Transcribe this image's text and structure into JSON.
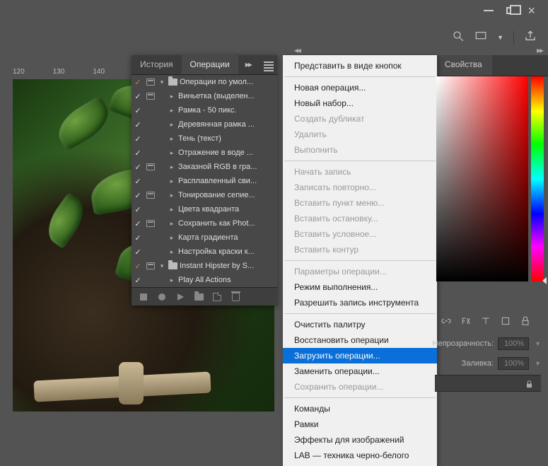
{
  "window": {
    "minimize": "minimize",
    "maximize": "maximize",
    "close": "×"
  },
  "ruler": [
    "120",
    "130",
    "140"
  ],
  "panel": {
    "tab_history": "История",
    "tab_actions": "Операции",
    "items": [
      {
        "check": "✓",
        "dialog": true,
        "expand": "▾",
        "folder": true,
        "label": "Операции по умол...",
        "group": true,
        "indent": 0
      },
      {
        "check": "✓",
        "dialog": true,
        "expand": "▸",
        "label": "Виньетка (выделен...",
        "indent": 1
      },
      {
        "check": "✓",
        "dialog": false,
        "expand": "▸",
        "label": "Рамка - 50 пикс.",
        "indent": 1
      },
      {
        "check": "✓",
        "dialog": false,
        "expand": "▸",
        "label": "Деревянная рамка ...",
        "indent": 1
      },
      {
        "check": "✓",
        "dialog": false,
        "expand": "▸",
        "label": "Тень (текст)",
        "indent": 1
      },
      {
        "check": "✓",
        "dialog": false,
        "expand": "▸",
        "label": "Отражение в воде ...",
        "indent": 1
      },
      {
        "check": "✓",
        "dialog": true,
        "expand": "▸",
        "label": "Заказной RGB в гра...",
        "indent": 1
      },
      {
        "check": "✓",
        "dialog": false,
        "expand": "▸",
        "label": "Расплавленный сви...",
        "indent": 1
      },
      {
        "check": "✓",
        "dialog": true,
        "expand": "▸",
        "label": "Тонирование сепие...",
        "indent": 1
      },
      {
        "check": "✓",
        "dialog": false,
        "expand": "▸",
        "label": "Цвета квадранта",
        "indent": 1
      },
      {
        "check": "✓",
        "dialog": true,
        "expand": "▸",
        "label": "Сохранить как Phot...",
        "indent": 1
      },
      {
        "check": "✓",
        "dialog": false,
        "expand": "▸",
        "label": "Карта градиента",
        "indent": 1
      },
      {
        "check": "✓",
        "dialog": false,
        "expand": "▸",
        "label": "Настройка краски к...",
        "indent": 1
      },
      {
        "check": "✓",
        "dialog": true,
        "expand": "▾",
        "folder": true,
        "label": "Instant Hipster by S...",
        "group": true,
        "indent": 0
      },
      {
        "check": "✓",
        "dialog": false,
        "expand": "▸",
        "label": "Play All Actions",
        "indent": 1
      }
    ]
  },
  "flyout": [
    {
      "label": "Представить в виде кнопок",
      "enabled": true
    },
    {
      "sep": true
    },
    {
      "label": "Новая операция...",
      "enabled": true
    },
    {
      "label": "Новый набор...",
      "enabled": true
    },
    {
      "label": "Создать дубликат",
      "enabled": false
    },
    {
      "label": "Удалить",
      "enabled": false
    },
    {
      "label": "Выполнить",
      "enabled": false
    },
    {
      "sep": true
    },
    {
      "label": "Начать запись",
      "enabled": false
    },
    {
      "label": "Записать повторно...",
      "enabled": false
    },
    {
      "label": "Вставить пункт меню...",
      "enabled": false
    },
    {
      "label": "Вставить остановку...",
      "enabled": false
    },
    {
      "label": "Вставить условное...",
      "enabled": false
    },
    {
      "label": "Вставить контур",
      "enabled": false
    },
    {
      "sep": true
    },
    {
      "label": "Параметры операции...",
      "enabled": false
    },
    {
      "label": "Режим выполнения...",
      "enabled": true
    },
    {
      "label": "Разрешить запись инструмента",
      "enabled": true
    },
    {
      "sep": true
    },
    {
      "label": "Очистить палитру",
      "enabled": true
    },
    {
      "label": "Восстановить операции",
      "enabled": true
    },
    {
      "label": "Загрузить операции...",
      "enabled": true,
      "highlight": true
    },
    {
      "label": "Заменить операции...",
      "enabled": true
    },
    {
      "label": "Сохранить операции...",
      "enabled": false
    },
    {
      "sep": true
    },
    {
      "label": "Команды",
      "enabled": true
    },
    {
      "label": "Рамки",
      "enabled": true
    },
    {
      "label": "Эффекты для изображений",
      "enabled": true
    },
    {
      "label": "LAB — техника черно-белого",
      "enabled": true
    }
  ],
  "right_tab": {
    "properties": "Свойства"
  },
  "props": {
    "opacity_label": "Непрозрачность:",
    "opacity_value": "100%",
    "fill_label": "Заливка:",
    "fill_value": "100%"
  }
}
